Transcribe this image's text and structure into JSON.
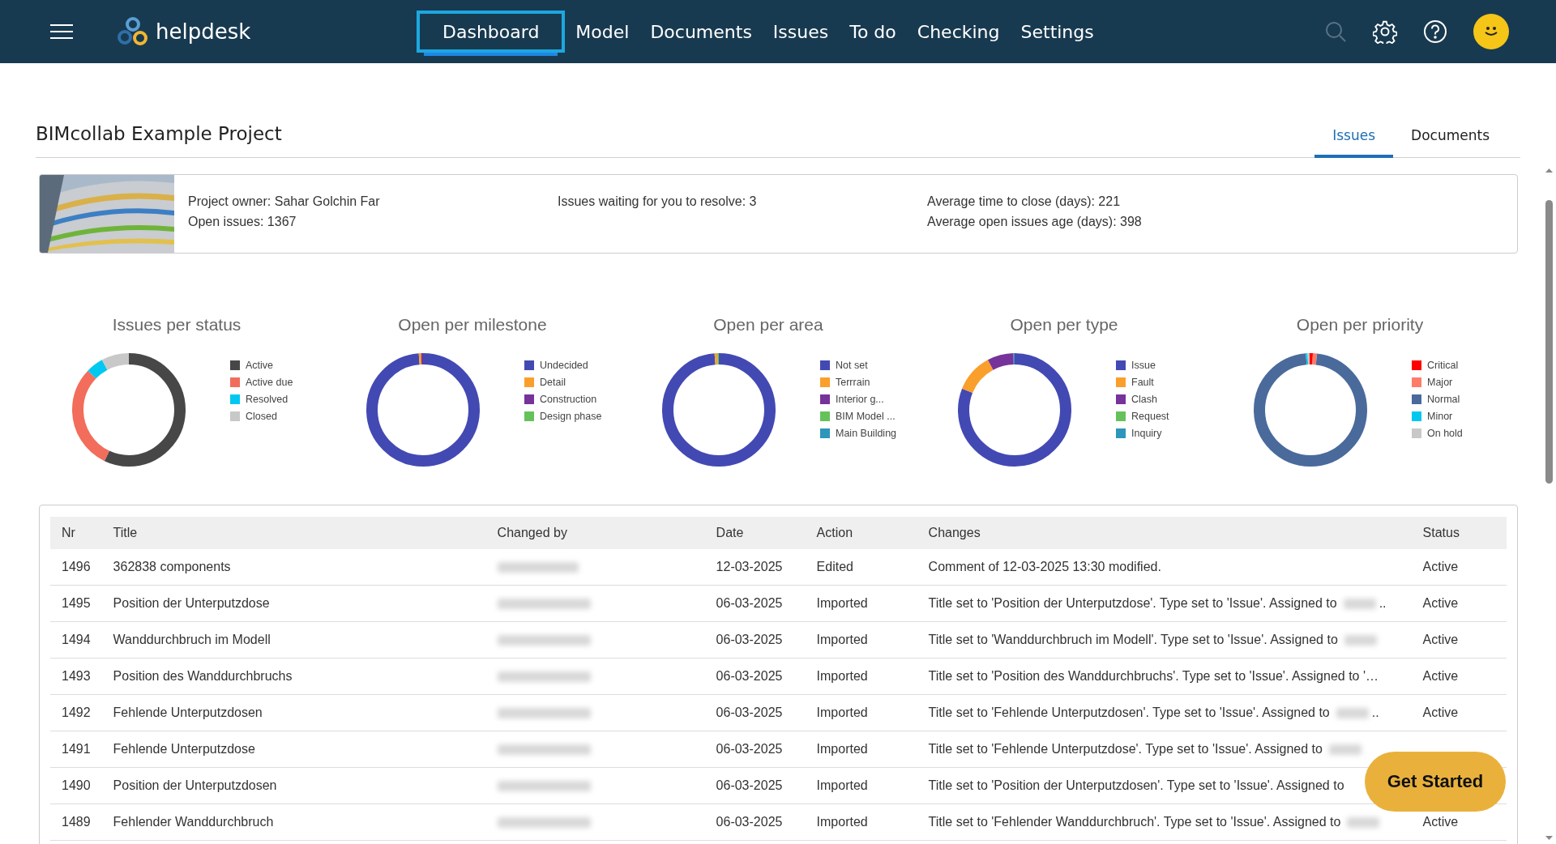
{
  "nav": {
    "logo": "helpdesk",
    "items": [
      {
        "label": "Dashboard",
        "selected": true
      },
      {
        "label": "Model",
        "selected": false
      },
      {
        "label": "Documents",
        "selected": false
      },
      {
        "label": "Issues",
        "selected": false
      },
      {
        "label": "To do",
        "selected": false
      },
      {
        "label": "Checking",
        "selected": false
      },
      {
        "label": "Settings",
        "selected": false
      }
    ]
  },
  "project": {
    "title": "BIMcollab Example Project",
    "tabs": [
      {
        "label": "Issues",
        "selected": true
      },
      {
        "label": "Documents",
        "selected": false
      }
    ]
  },
  "info": {
    "picture": {
      "kind": "picture"
    },
    "columns": [
      [
        "Project owner: Sahar Golchin Far",
        "Open issues: 1367"
      ],
      [
        "Issues waiting for you to resolve: 3"
      ],
      [
        "Average time to close (days): 221",
        "Average open issues age (days): 398"
      ]
    ]
  },
  "charts": [
    {
      "title": "Issues per status",
      "legend": [
        {
          "label": "Active",
          "color": "#474747"
        },
        {
          "label": "Active due",
          "color": "#f26d5b"
        },
        {
          "label": "Resolved",
          "color": "#00c8f0"
        },
        {
          "label": "Closed",
          "color": "#c8c8c8"
        }
      ]
    },
    {
      "title": "Open per milestone",
      "legend": [
        {
          "label": "Undecided",
          "color": "#4349b3"
        },
        {
          "label": "Detail",
          "color": "#fa9f2c"
        },
        {
          "label": "Construction",
          "color": "#76339a"
        },
        {
          "label": "Design phase",
          "color": "#65c25b"
        }
      ]
    },
    {
      "title": "Open per area",
      "legend": [
        {
          "label": "Not set",
          "color": "#4349b3"
        },
        {
          "label": "Terrrain",
          "color": "#fa9f2c"
        },
        {
          "label": "Interior g...",
          "color": "#76339a"
        },
        {
          "label": "BIM Model ...",
          "color": "#65c25b"
        },
        {
          "label": "Main Building",
          "color": "#2d96bb"
        }
      ]
    },
    {
      "title": "Open per type",
      "legend": [
        {
          "label": "Issue",
          "color": "#4349b3"
        },
        {
          "label": "Fault",
          "color": "#fa9f2c"
        },
        {
          "label": "Clash",
          "color": "#76339a"
        },
        {
          "label": "Request",
          "color": "#65c25b"
        },
        {
          "label": "Inquiry",
          "color": "#2d96bb"
        }
      ]
    },
    {
      "title": "Open per priority",
      "legend": [
        {
          "label": "Critical",
          "color": "#fe0000"
        },
        {
          "label": "Major",
          "color": "#fd7d68"
        },
        {
          "label": "Normal",
          "color": "#4a6a9c"
        },
        {
          "label": "Minor",
          "color": "#00c8f0"
        },
        {
          "label": "On hold",
          "color": "#c8c8c8"
        }
      ]
    }
  ],
  "table": {
    "columns": [
      "Nr",
      "Title",
      "Changed by",
      "Date",
      "Action",
      "Changes",
      "Status"
    ],
    "rows": [
      {
        "nr": "1496",
        "title": "362838 components",
        "changed_by_blurred": true,
        "date": "12-03-2025",
        "action": "Edited",
        "changes": "Comment of 12-03-2025 13:30 modified.",
        "assignee_blurred": false,
        "ellipsis": "",
        "status": "Active"
      },
      {
        "nr": "1495",
        "title": "Position der Unterputzdose",
        "changed_by_blurred": true,
        "date": "06-03-2025",
        "action": "Imported",
        "changes": "Title set to 'Position der Unterputzdose'. Type set to 'Issue'. Assigned to",
        "assignee_blurred": true,
        "ellipsis": "..",
        "status": "Active"
      },
      {
        "nr": "1494",
        "title": "Wanddurchbruch im Modell",
        "changed_by_blurred": true,
        "date": "06-03-2025",
        "action": "Imported",
        "changes": "Title set to 'Wanddurchbruch im Modell'. Type set to 'Issue'. Assigned to",
        "assignee_blurred": true,
        "ellipsis": "",
        "status": "Active"
      },
      {
        "nr": "1493",
        "title": "Position des Wanddurchbruchs",
        "changed_by_blurred": true,
        "date": "06-03-2025",
        "action": "Imported",
        "changes": "Title set to 'Position des Wanddurchbruchs'. Type set to 'Issue'. Assigned to '…",
        "assignee_blurred": false,
        "ellipsis": "",
        "status": "Active"
      },
      {
        "nr": "1492",
        "title": "Fehlende Unterputzdosen",
        "changed_by_blurred": true,
        "date": "06-03-2025",
        "action": "Imported",
        "changes": "Title set to 'Fehlende Unterputzdosen'. Type set to 'Issue'. Assigned to",
        "assignee_blurred": true,
        "ellipsis": "..",
        "status": "Active"
      },
      {
        "nr": "1491",
        "title": "Fehlende Unterputzdose",
        "changed_by_blurred": true,
        "date": "06-03-2025",
        "action": "Imported",
        "changes": "Title set to 'Fehlende Unterputzdose'. Type set to 'Issue'. Assigned to",
        "assignee_blurred": true,
        "ellipsis": "",
        "status": ""
      },
      {
        "nr": "1490",
        "title": "Position der Unterputzdosen",
        "changed_by_blurred": true,
        "date": "06-03-2025",
        "action": "Imported",
        "changes": "Title set to 'Position der Unterputzdosen'. Type set to 'Issue'. Assigned to",
        "assignee_blurred": false,
        "ellipsis": "",
        "status": ""
      },
      {
        "nr": "1489",
        "title": "Fehlender Wanddurchbruch",
        "changed_by_blurred": true,
        "date": "06-03-2025",
        "action": "Imported",
        "changes": "Title set to 'Fehlender Wanddurchbruch'. Type set to 'Issue'. Assigned to",
        "assignee_blurred": true,
        "ellipsis": "",
        "status": "Active"
      }
    ]
  },
  "get_started": "Get Started"
}
